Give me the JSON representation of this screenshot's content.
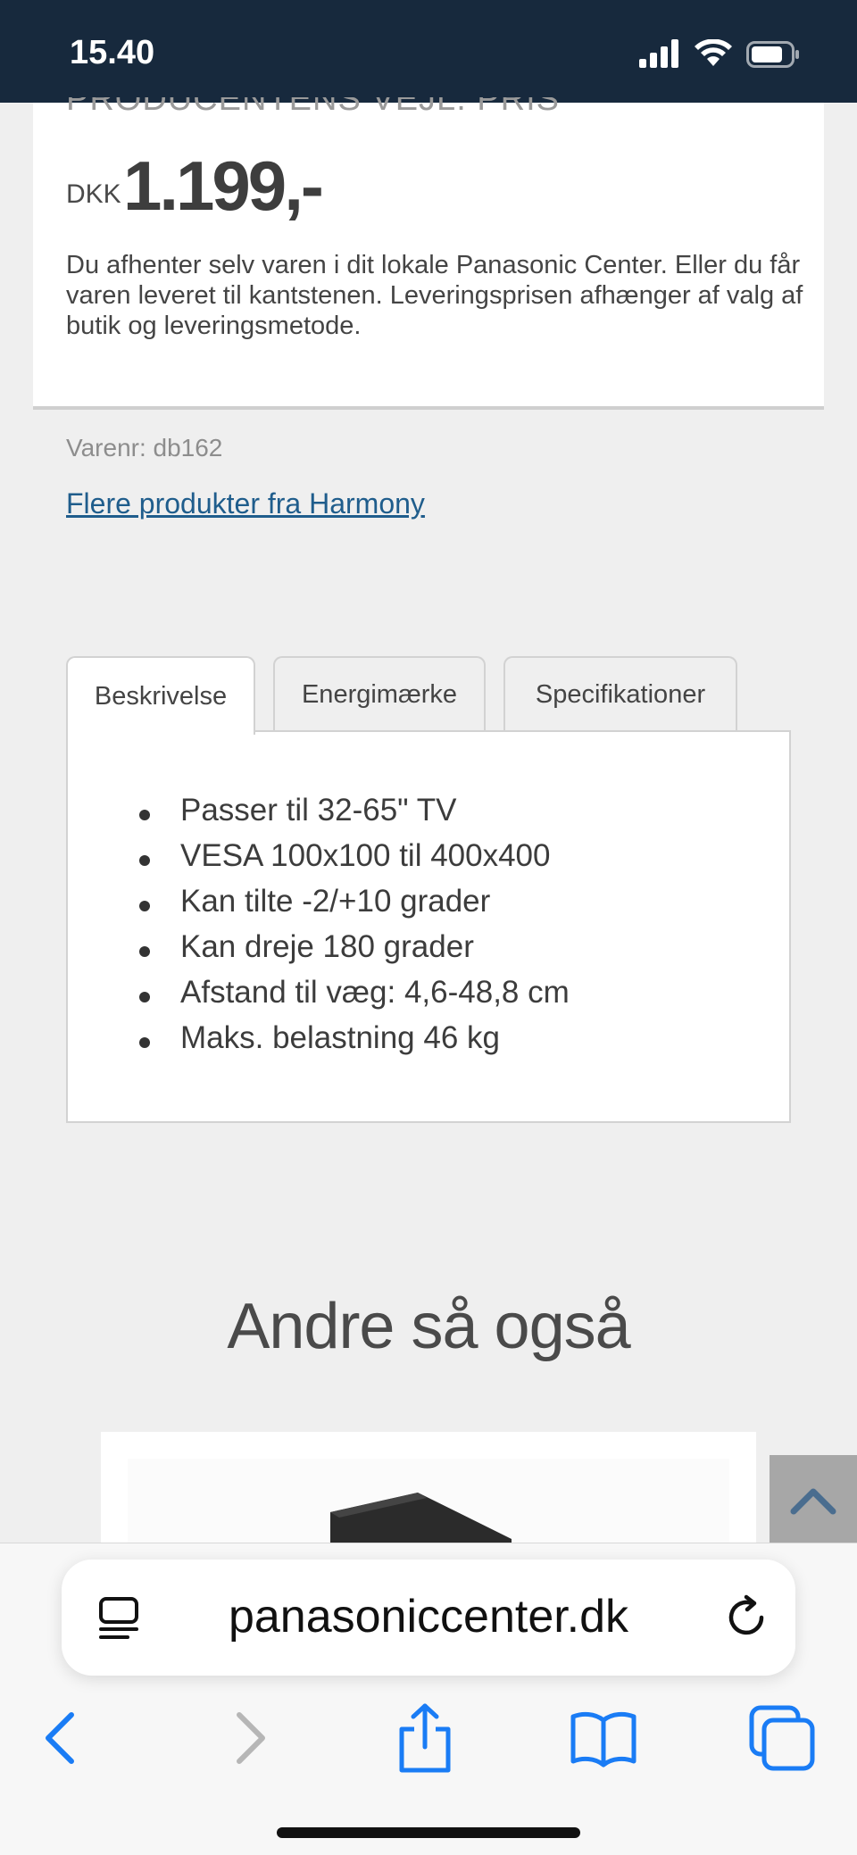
{
  "status_bar": {
    "time": "15.40",
    "icons": [
      "signal-icon",
      "wifi-icon",
      "battery-icon"
    ]
  },
  "price_box": {
    "heading": "PRODUCENTENS VEJL. PRIS",
    "currency": "DKK",
    "price": "1.199,-",
    "delivery_text": "Du afhenter selv varen i dit lokale Panasonic Center. Eller du får varen leveret til kantstenen. Leveringsprisen afhænger af valg af butik og leveringsmetode."
  },
  "product_meta": {
    "sku": "Varenr: db162",
    "brand_link": "Flere produkter fra Harmony"
  },
  "tabs": [
    {
      "label": "Beskrivelse",
      "active": true
    },
    {
      "label": "Energimærke",
      "active": false
    },
    {
      "label": "Specifikationer",
      "active": false
    }
  ],
  "description": {
    "features": [
      "Passer til 32-65\" TV",
      "VESA 100x100 til 400x400",
      "Kan tilte -2/+10 grader",
      "Kan dreje 180 grader",
      "Afstand til væg: 4,6-48,8 cm",
      "Maks. belastning 46 kg"
    ]
  },
  "related": {
    "title": "Andre så også"
  },
  "browser": {
    "url": "panasoniccenter.dk",
    "icons": [
      "reader-icon",
      "reload-icon",
      "back-icon",
      "forward-icon",
      "share-icon",
      "bookmarks-icon",
      "tabs-icon"
    ],
    "accent_color": "#1a7cf5"
  },
  "colors": {
    "status_bar_bg": "#17293d",
    "link": "#1f5d8c"
  }
}
